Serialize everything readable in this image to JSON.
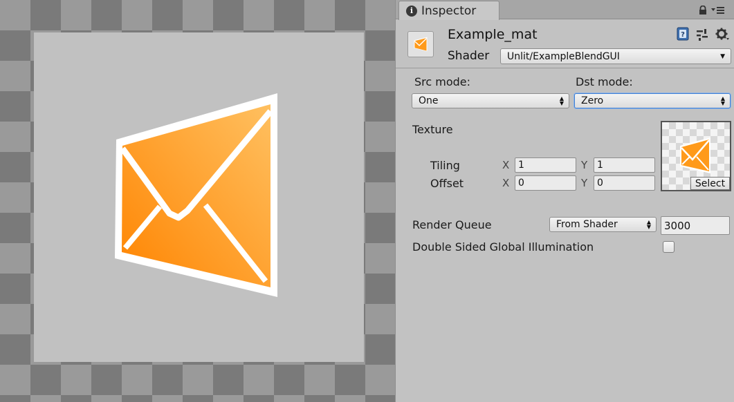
{
  "window": {
    "tab_label": "Inspector"
  },
  "icons": {
    "info": "info-icon",
    "lock": "lock-icon",
    "tab_menu": "tab-menu-icon",
    "help": "help-icon",
    "preset": "preset-icon",
    "gear": "gear-icon",
    "envelope": "envelope-icon"
  },
  "colors": {
    "envelope_orange_light": "#ffb74a",
    "envelope_orange_dark": "#ff8a00",
    "focus_blue": "#3f7fd4"
  },
  "material": {
    "name": "Example_mat",
    "shader_label": "Shader",
    "shader_value": "Unlit/ExampleBlendGUI"
  },
  "blend": {
    "src_label": "Src mode:",
    "src_value": "One",
    "dst_label": "Dst mode:",
    "dst_value": "Zero"
  },
  "texture": {
    "label": "Texture",
    "tiling_label": "Tiling",
    "offset_label": "Offset",
    "x_axis": "X",
    "y_axis": "Y",
    "tiling_x": "1",
    "tiling_y": "1",
    "offset_x": "0",
    "offset_y": "0",
    "select_label": "Select"
  },
  "render_queue": {
    "label": "Render Queue",
    "mode": "From Shader",
    "value": "3000"
  },
  "double_sided_gi": {
    "label": "Double Sided Global Illumination",
    "checked": false
  }
}
